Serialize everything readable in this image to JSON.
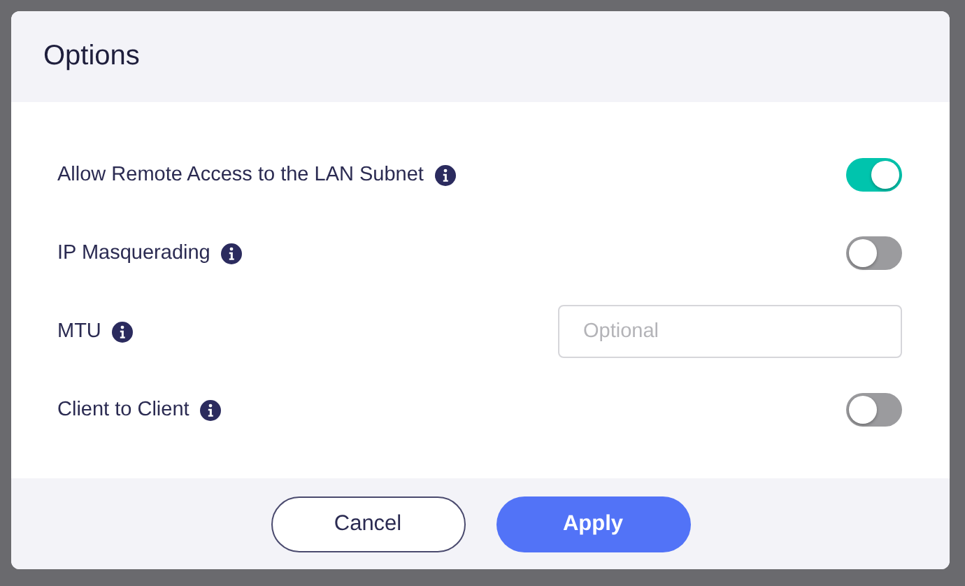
{
  "dialog": {
    "title": "Options"
  },
  "settings": [
    {
      "kind": "toggle",
      "label": "Allow Remote Access to the LAN Subnet",
      "on": true
    },
    {
      "kind": "toggle",
      "label": "IP Masquerading",
      "on": false
    },
    {
      "kind": "input",
      "label": "MTU",
      "placeholder": "Optional"
    },
    {
      "kind": "toggle",
      "label": "Client to Client",
      "on": false
    }
  ],
  "buttons": [
    {
      "kind": "secondary",
      "label": "Cancel"
    },
    {
      "kind": "primary",
      "label": "Apply"
    }
  ]
}
